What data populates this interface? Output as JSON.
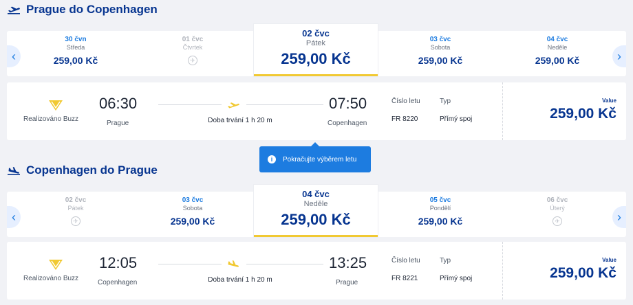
{
  "outbound": {
    "title": "Prague do Copenhagen",
    "dates": [
      {
        "date": "30 čvn",
        "weekday": "Středa",
        "price": "259,00 Kč",
        "available": true
      },
      {
        "date": "01 čvc",
        "weekday": "Čtvrtek",
        "price": "",
        "available": false
      },
      {
        "date": "02 čvc",
        "weekday": "Pátek",
        "price": "259,00 Kč",
        "available": true,
        "selected": true
      },
      {
        "date": "03 čvc",
        "weekday": "Sobota",
        "price": "259,00 Kč",
        "available": true
      },
      {
        "date": "04 čvc",
        "weekday": "Neděle",
        "price": "259,00 Kč",
        "available": true
      }
    ],
    "flight": {
      "operated_by": "Realizováno Buzz",
      "depart_time": "06:30",
      "depart_city": "Prague",
      "duration": "Doba trvání 1 h 20 m",
      "arrive_time": "07:50",
      "arrive_city": "Copenhagen",
      "flight_no_label": "Číslo letu",
      "flight_no": "FR 8220",
      "type_label": "Typ",
      "type": "Přímý spoj",
      "fare_label": "Value",
      "price": "259,00 Kč"
    }
  },
  "tooltip": {
    "text": "Pokračujte výběrem letu"
  },
  "inbound": {
    "title": "Copenhagen do Prague",
    "dates": [
      {
        "date": "02 čvc",
        "weekday": "Pátek",
        "price": "",
        "available": false
      },
      {
        "date": "03 čvc",
        "weekday": "Sobota",
        "price": "259,00 Kč",
        "available": true
      },
      {
        "date": "04 čvc",
        "weekday": "Neděle",
        "price": "259,00 Kč",
        "available": true,
        "selected": true
      },
      {
        "date": "05 čvc",
        "weekday": "Pondělí",
        "price": "259,00 Kč",
        "available": true
      },
      {
        "date": "06 čvc",
        "weekday": "Úterý",
        "price": "",
        "available": false
      }
    ],
    "flight": {
      "operated_by": "Realizováno Buzz",
      "depart_time": "12:05",
      "depart_city": "Copenhagen",
      "duration": "Doba trvání 1 h 20 m",
      "arrive_time": "13:25",
      "arrive_city": "Prague",
      "flight_no_label": "Číslo letu",
      "flight_no": "FR 8221",
      "type_label": "Typ",
      "type": "Přímý spoj",
      "fare_label": "Value",
      "price": "259,00 Kč"
    }
  },
  "icons": {
    "depart": "plane-takeoff-icon",
    "arrive": "plane-landing-icon",
    "prev": "chevron-left-icon",
    "next": "chevron-right-icon",
    "no_flight": "no-flight-icon",
    "info": "info-icon",
    "airline": "buzz-logo-icon"
  },
  "colors": {
    "brand": "#073590",
    "accent": "#f1c933",
    "link": "#1d7ce0"
  }
}
